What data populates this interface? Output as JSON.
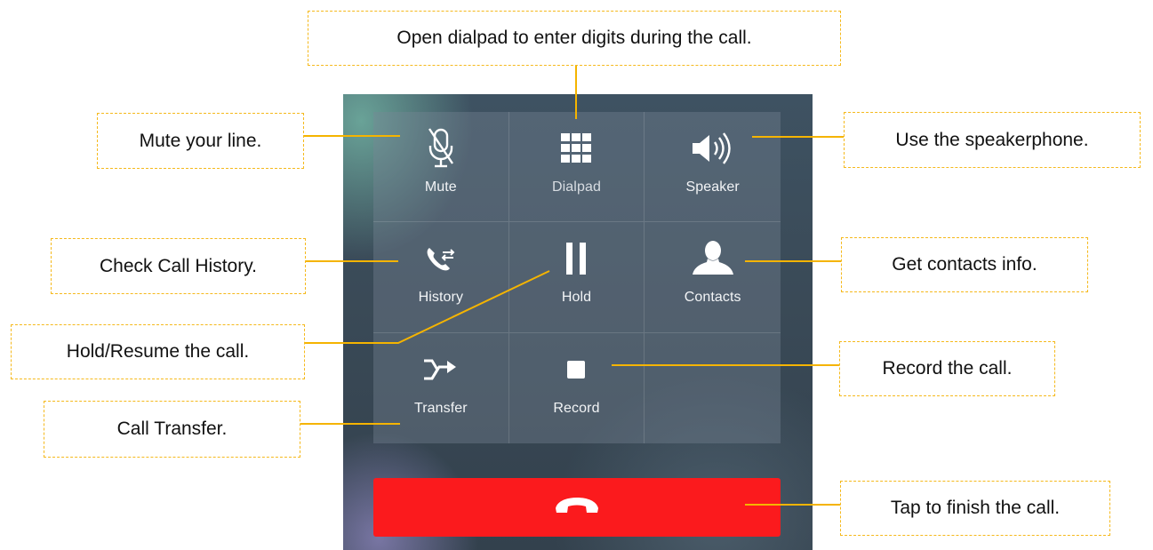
{
  "controls": [
    {
      "label": "Mute",
      "icon": "microphone-muted-icon",
      "callout": "Mute your line."
    },
    {
      "label": "Dialpad",
      "icon": "dialpad-grid-icon",
      "callout": "Open dialpad to enter digits during the call."
    },
    {
      "label": "Speaker",
      "icon": "speaker-icon",
      "callout": "Use the speakerphone."
    },
    {
      "label": "History",
      "icon": "call-history-icon",
      "callout": "Check Call History."
    },
    {
      "label": "Hold",
      "icon": "pause-icon",
      "callout": "Hold/Resume the call."
    },
    {
      "label": "Contacts",
      "icon": "contact-person-icon",
      "callout": "Get contacts info."
    },
    {
      "label": "Transfer",
      "icon": "transfer-arrow-icon",
      "callout": "Call Transfer."
    },
    {
      "label": "Record",
      "icon": "stop-square-icon",
      "callout": "Record the call."
    }
  ],
  "end_call": {
    "icon": "hang-up-phone-icon",
    "callout": "Tap to finish the call."
  },
  "colors": {
    "end_call_button": "#fb1a1d",
    "callout_border": "#f5b91c",
    "leader_line": "#f5b400",
    "screen_background": "#3a4a57"
  }
}
